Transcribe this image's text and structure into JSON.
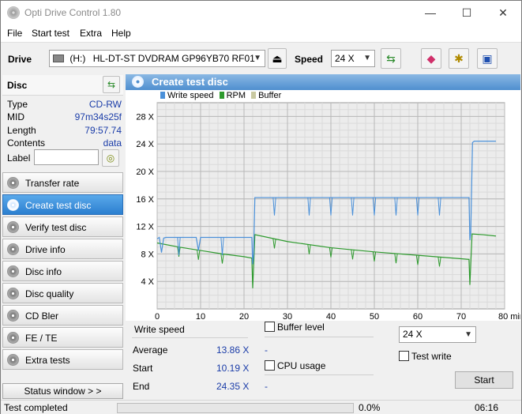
{
  "window": {
    "title": "Opti Drive Control 1.80",
    "minimize": "—",
    "maximize": "☐",
    "close": "✕"
  },
  "menu": [
    "File",
    "Start test",
    "Extra",
    "Help"
  ],
  "toolbar": {
    "drive_label": "Drive",
    "drive_letter": "(H:)",
    "drive_value": "HL-DT-ST DVDRAM GP96YB70 RF01",
    "speed_label": "Speed",
    "speed_value": "24 X"
  },
  "disc": {
    "header": "Disc",
    "rows": [
      {
        "key": "Type",
        "value": "CD-RW"
      },
      {
        "key": "MID",
        "value": "97m34s25f"
      },
      {
        "key": "Length",
        "value": "79:57.74"
      },
      {
        "key": "Contents",
        "value": "data"
      }
    ],
    "label_key": "Label"
  },
  "nav": [
    {
      "label": "Transfer rate",
      "active": false
    },
    {
      "label": "Create test disc",
      "active": true
    },
    {
      "label": "Verify test disc",
      "active": false
    },
    {
      "label": "Drive info",
      "active": false
    },
    {
      "label": "Disc info",
      "active": false
    },
    {
      "label": "Disc quality",
      "active": false
    },
    {
      "label": "CD Bler",
      "active": false
    },
    {
      "label": "FE / TE",
      "active": false
    },
    {
      "label": "Extra tests",
      "active": false
    }
  ],
  "status_window_btn": "Status window > >",
  "panel_title": "Create test disc",
  "chart_data": {
    "type": "line",
    "legend": [
      "Write speed",
      "RPM",
      "Buffer"
    ],
    "colors": {
      "write_speed": "#4a90d9",
      "rpm": "#2e9a2e",
      "buffer": "#c8c8a0"
    },
    "xlim": [
      0,
      80
    ],
    "ylim": [
      0,
      30
    ],
    "x_ticks": [
      0,
      10,
      20,
      30,
      40,
      50,
      60,
      70,
      80
    ],
    "x_tick_labels": [
      "0",
      "10",
      "20",
      "30",
      "40",
      "50",
      "60",
      "70",
      "80 min"
    ],
    "y_ticks": [
      4,
      8,
      12,
      16,
      20,
      24,
      28
    ],
    "y_tick_labels": [
      "4 X",
      "8 X",
      "12 X",
      "16 X",
      "20 X",
      "24 X",
      "28 X"
    ],
    "grid": true,
    "series": [
      {
        "name": "Write speed",
        "x": [
          0,
          0.5,
          1,
          1.5,
          2,
          4,
          6,
          8,
          9,
          9.5,
          10,
          12,
          15,
          17,
          19,
          21,
          21.8,
          22,
          22.2,
          22.5,
          25,
          28,
          30,
          35,
          40,
          45,
          50,
          55,
          60,
          65,
          70,
          71.8,
          72,
          72.2,
          72.6,
          73,
          75,
          78
        ],
        "y": [
          10.2,
          10.4,
          8.2,
          10.3,
          10.4,
          10.4,
          10.4,
          10.4,
          10.4,
          8.5,
          10.4,
          10.4,
          10.4,
          10.4,
          10.4,
          10.4,
          10.4,
          6.5,
          8.0,
          16.2,
          16.2,
          16.2,
          16.2,
          16.2,
          16.2,
          16.2,
          16.2,
          16.2,
          16.2,
          16.2,
          16.2,
          16.2,
          10.0,
          11.0,
          24.2,
          24.4,
          24.4,
          24.4
        ],
        "dips_x": [
          5,
          9.5,
          15,
          22,
          27,
          35,
          40,
          45,
          50,
          55,
          60,
          65,
          72
        ]
      },
      {
        "name": "RPM",
        "x": [
          0,
          5,
          10,
          15,
          20,
          21.8,
          22,
          22.5,
          30,
          40,
          50,
          60,
          70,
          71.8,
          72,
          72.5,
          75,
          78
        ],
        "y": [
          9.6,
          9.0,
          8.5,
          8.0,
          7.6,
          7.4,
          3.0,
          10.8,
          9.8,
          8.9,
          8.3,
          7.8,
          7.3,
          7.2,
          3.5,
          10.9,
          10.8,
          10.6
        ]
      }
    ]
  },
  "stats": {
    "title": "Write speed",
    "rows": [
      {
        "label": "Average",
        "value": "13.86 X",
        "extra": "-"
      },
      {
        "label": "Start",
        "value": "10.19 X",
        "extra": "-"
      },
      {
        "label": "End",
        "value": "24.35 X",
        "extra": "-"
      }
    ],
    "buffer_level": "Buffer level",
    "cpu_usage": "CPU usage",
    "speed_select": "24 X",
    "test_write": "Test write",
    "start": "Start"
  },
  "statusbar": {
    "text": "Test completed",
    "progress": 0,
    "percent": "0.0%",
    "time": "06:16"
  }
}
